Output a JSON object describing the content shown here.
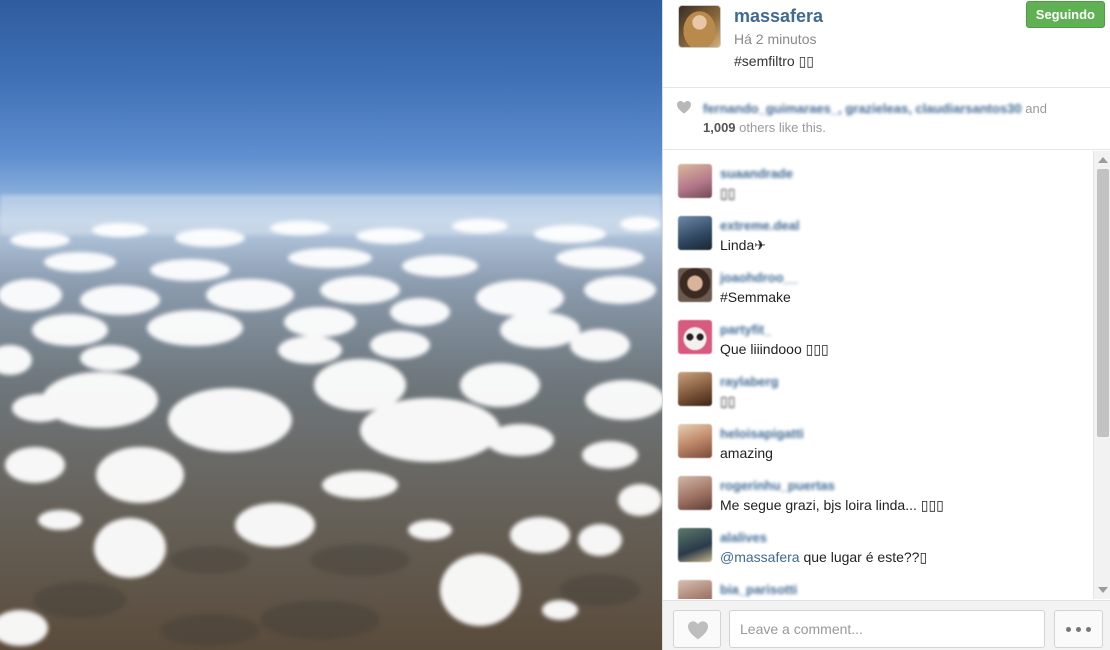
{
  "photo": {
    "subject": "aerial view of clouds above farmland",
    "sky_color": "#3f70b6"
  },
  "header": {
    "username": "massafera",
    "time": "Há 2 minutos",
    "caption": "#semfiltro ▯▯",
    "follow_label": "Seguindo",
    "follow_color": "#5fb153"
  },
  "likes": {
    "names": "fernando_guimaraes_, grazieleas, claudiarsantos30",
    "and_text": " and",
    "count": "1,009",
    "others_text": " others like this."
  },
  "comments": [
    {
      "user": "suaandrade",
      "text": "▯▯",
      "blur": true
    },
    {
      "user": "extreme.deal",
      "text": "Linda✈",
      "blur": false
    },
    {
      "user": "joaohdroo__",
      "text": "#Semmake",
      "blur": false
    },
    {
      "user": "partyfit_",
      "text": "Que liiindooo ▯▯▯",
      "blur": false
    },
    {
      "user": "raylaberg",
      "text": "▯▯",
      "blur": true
    },
    {
      "user": "heloisapigatti",
      "text": "amazing",
      "blur": false
    },
    {
      "user": "rogerinhu_puertas",
      "text": "Me segue grazi, bjs loira linda... ▯▯▯",
      "blur": false
    },
    {
      "user": "alalives",
      "mention": "@massafera",
      "text": " que lugar é este??▯",
      "blur": false
    },
    {
      "user": "bia_parisotti",
      "text": "",
      "blur": false
    }
  ],
  "footer": {
    "comment_placeholder": "Leave a comment...",
    "like_icon": "heart-icon",
    "more_icon": "more-dots-icon"
  },
  "colors": {
    "link": "#3f6a93",
    "follow": "#5fb153",
    "muted": "#999999"
  }
}
